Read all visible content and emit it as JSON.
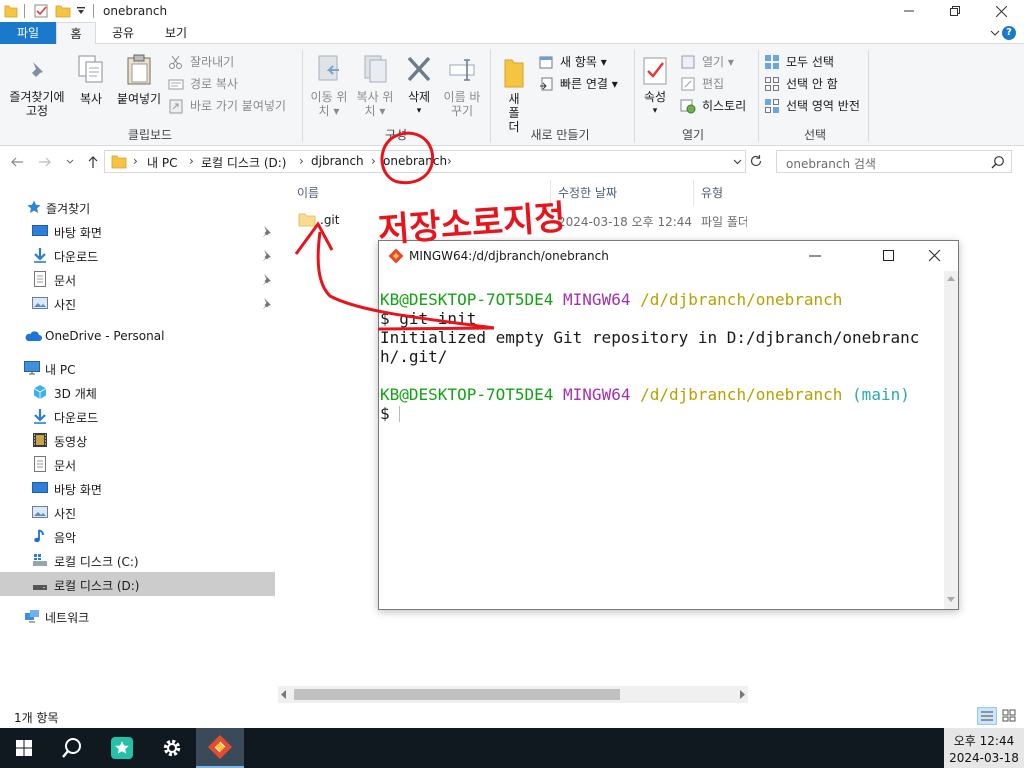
{
  "window": {
    "title": "onebranch",
    "tabs": [
      "파일",
      "홈",
      "공유",
      "보기"
    ],
    "help": "?"
  },
  "ribbon": {
    "clipboard": {
      "pin": "즐겨찾기에 고정",
      "copy": "복사",
      "paste": "붙여넣기",
      "cut": "잘라내기",
      "copy_path": "경로 복사",
      "paste_shortcut": "바로 가기 붙여넣기",
      "label": "클립보드"
    },
    "organize": {
      "move_to": "이동 위치",
      "copy_to": "복사 위치",
      "delete": "삭제",
      "rename": "이름 바꾸기",
      "label": "구성"
    },
    "new": {
      "new_folder": "새 폴더",
      "new_item": "새 항목",
      "easy_access": "빠른 연결",
      "label": "새로 만들기"
    },
    "open": {
      "properties": "속성",
      "open": "열기",
      "edit": "편집",
      "history": "히스토리",
      "label": "열기"
    },
    "select": {
      "select_all": "모두 선택",
      "select_none": "선택 안 함",
      "invert": "선택 영역 반전",
      "label": "선택"
    }
  },
  "address": {
    "crumbs": [
      "내 PC",
      "로컬 디스크 (D:)",
      "djbranch",
      "onebranch"
    ],
    "search_placeholder": "onebranch 검색"
  },
  "nav": {
    "quick_access": "즐겨찾기",
    "quick_items": [
      "바탕 화면",
      "다운로드",
      "문서",
      "사진"
    ],
    "onedrive": "OneDrive - Personal",
    "this_pc": "내 PC",
    "pc_items": [
      "3D 개체",
      "다운로드",
      "동영상",
      "문서",
      "바탕 화면",
      "사진",
      "음악",
      "로컬 디스크 (C:)",
      "로컬 디스크 (D:)"
    ],
    "network": "네트워크"
  },
  "content": {
    "columns": [
      "이름",
      "수정한 날짜",
      "유형"
    ],
    "rows": [
      {
        "name": ".git",
        "modified": "2024-03-18 오후 12:44",
        "type": "파일 폴더"
      }
    ]
  },
  "status": {
    "count": "1개 항목"
  },
  "terminal": {
    "title": "MINGW64:/d/djbranch/onebranch",
    "user_host": "KB@DESKTOP-7OT5DE4",
    "env": "MINGW64",
    "path": "/d/djbranch/onebranch",
    "cmd": "$ git init",
    "output1": "Initialized empty Git repository in D:/djbranch/onebranc",
    "output2": "h/.git/",
    "branch": "(main)",
    "prompt": "$",
    "colors": {
      "user": "#12a312",
      "env": "#a52eb5",
      "path": "#b9a000",
      "branch": "#2aa9b4"
    }
  },
  "annotation": {
    "text": "저장소로지정",
    "color": "#e8141b"
  },
  "taskbar": {
    "time": "오후 12:44",
    "date": "2024-03-18"
  },
  "colors": {
    "accent": "#1979ca",
    "taskbar": "#101820",
    "folder": "#f6c443"
  }
}
